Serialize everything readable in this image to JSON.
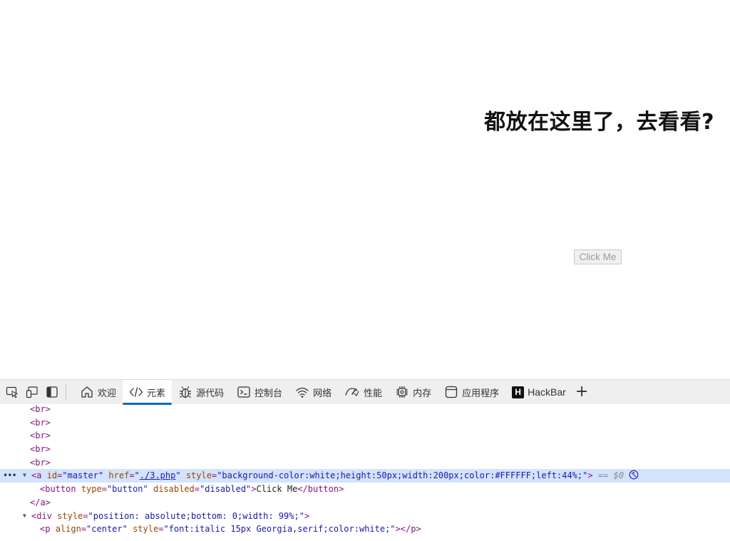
{
  "page": {
    "heading": "都放在这里了，去看看?",
    "button_label": "Click Me"
  },
  "toolbar": {
    "icons": [
      "inspect-icon",
      "device-emulation-icon",
      "dock-sidebar-icon"
    ],
    "tabs": [
      {
        "label": "欢迎",
        "icon": "home-icon"
      },
      {
        "label": "元素",
        "icon": "code-icon"
      },
      {
        "label": "源代码",
        "icon": "bug-icon"
      },
      {
        "label": "控制台",
        "icon": "console-icon"
      },
      {
        "label": "网络",
        "icon": "wifi-icon"
      },
      {
        "label": "性能",
        "icon": "performance-icon"
      },
      {
        "label": "内存",
        "icon": "memory-chip-icon"
      },
      {
        "label": "应用程序",
        "icon": "application-icon"
      },
      {
        "label": "HackBar",
        "icon": "H"
      }
    ],
    "active_tab": "元素",
    "add_tab_glyph": "+"
  },
  "elements": {
    "br_tag": "<br>",
    "selected_row": {
      "ellipsis": "•••",
      "open": "<a",
      "attr_id": "id",
      "eq": "=",
      "val_id": "\"master\"",
      "attr_href": "href",
      "q": "\"",
      "val_href": "./3.php",
      "attr_style": "style",
      "val_style": "\"background-color:white;height:50px;width:200px;color:#FFFFFF;left:44%;\"",
      "close": ">",
      "marker": "== $0"
    },
    "button_row": {
      "open": "<button",
      "attr_type": "type",
      "val_type": "\"button\"",
      "attr_disabled": "disabled",
      "val_disabled": "\"disabled\"",
      "gt": ">",
      "text": "Click Me",
      "close": "</button>"
    },
    "close_a": "</a>",
    "div_row": {
      "open": "<div",
      "attr_style": "style",
      "val_style": "\"position: absolute;bottom: 0;width: 99%;\"",
      "gt": ">"
    },
    "p_row": {
      "open": "<p",
      "attr_align": "align",
      "val_align": "\"center\"",
      "attr_style": "style",
      "val_style": "\"font:italic 15px Georgia,serif;color:white;\"",
      "gt": ">",
      "close": "</p>"
    }
  }
}
